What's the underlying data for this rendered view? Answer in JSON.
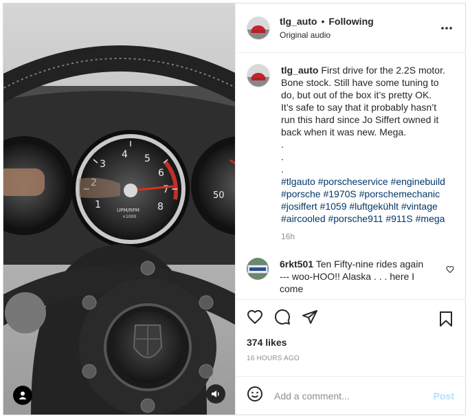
{
  "post": {
    "username": "tlg_auto",
    "separator": "•",
    "follow_status": "Following",
    "audio_label": "Original audio",
    "caption_text": "First drive for the 2.2S motor. Bone stock. Still have some tuning to do, but out of the box it’s pretty OK. It’s safe to say that it probably hasn’t run this hard since Jo Siffert owned it back when it was new. Mega.",
    "caption_dots": [
      ".",
      ".",
      "."
    ],
    "hashtags": "#tlgauto #porscheservice #enginebuild #porsche #1970S #porschemechanic #josiffert #1059 #luftgekühlt #vintage #aircooled #porsche911 #911S #mega",
    "caption_time": "16h",
    "likes": "374 likes",
    "date": "16 HOURS AGO"
  },
  "comment": {
    "username": "6rkt501",
    "text": "Ten Fifty-nine rides again --- woo-HOO!! Alaska . . . here I come"
  },
  "add_comment": {
    "placeholder": "Add a comment...",
    "post_label": "Post"
  },
  "gauges": {
    "tach_numbers": [
      "1",
      "2",
      "3",
      "4",
      "5",
      "6",
      "7",
      "8"
    ],
    "tach_unit": "UPM/RPM",
    "tach_multiplier": "×1000",
    "speedo_number": "50"
  },
  "icons": {
    "more": "more-options-icon",
    "like": "heart-icon",
    "comment": "comment-icon",
    "share": "share-icon",
    "save": "bookmark-icon",
    "emoji": "emoji-icon",
    "tag": "user-tag-icon",
    "audio": "audio-icon"
  },
  "colors": {
    "hashtag": "#00376b",
    "muted": "#8e8e8e",
    "post_button": "#b2dffc"
  }
}
